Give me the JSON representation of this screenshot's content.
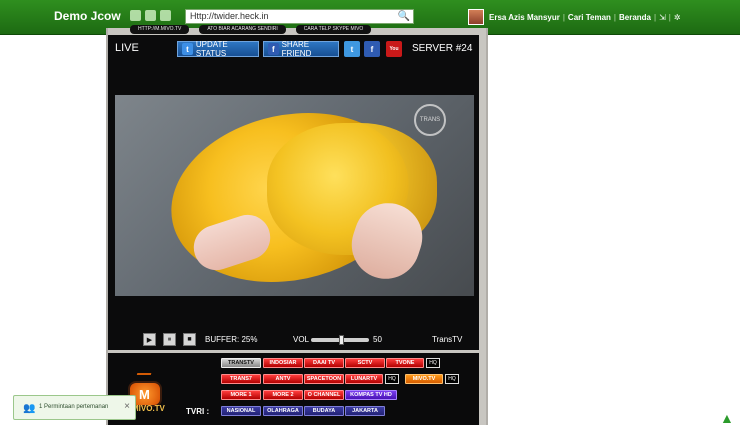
{
  "header": {
    "brand": "Demo Jcow",
    "url": "Http://twider.heck.in",
    "user_name": "Ersa Azis Mansyur",
    "nav_find_friends": "Cari Teman",
    "nav_home": "Beranda"
  },
  "player": {
    "live_label": "LIVE",
    "update_status": "UPDATE STATUS",
    "share_friend": "SHARE FRIEND",
    "server_label": "SERVER #24",
    "buffer_label": "BUFFER: 25%",
    "vol_label": "VOL",
    "vol_value": "50",
    "channel_name": "TransTV",
    "ticker_left": "HTTP://M.MIVO.TV",
    "ticker_mid": "ATO BIAR ACARANG SENDIRI",
    "ticker_right": "CARA TELP SKYPE MIVO"
  },
  "channels": {
    "row1": [
      {
        "label": "TRANSTV",
        "color": "gray"
      },
      {
        "label": "INDOSIAR",
        "color": "red"
      },
      {
        "label": "DAAI TV",
        "color": "red"
      },
      {
        "label": "SCTV",
        "color": "red"
      },
      {
        "label": "TVONE",
        "color": "red"
      }
    ],
    "row2": [
      {
        "label": "TRANS7",
        "color": "red"
      },
      {
        "label": "ANTV",
        "color": "red"
      },
      {
        "label": "SPACETOON",
        "color": "red"
      },
      {
        "label": "LUNARTV",
        "color": "red"
      },
      {
        "label": "MIVO.TV",
        "color": "orange"
      }
    ],
    "row3": [
      {
        "label": "MORE 1",
        "color": "red"
      },
      {
        "label": "MORE 2",
        "color": "red"
      },
      {
        "label": "O CHANNEL",
        "color": "red"
      },
      {
        "label": "KOMPAS TV HD",
        "color": "purple"
      }
    ],
    "row4_label": "TVRI :",
    "row4": [
      {
        "label": "NASIONAL",
        "color": "navy"
      },
      {
        "label": "OLAHRAGA",
        "color": "navy"
      },
      {
        "label": "BUDAYA",
        "color": "navy"
      },
      {
        "label": "JAKARTA",
        "color": "navy"
      }
    ],
    "hq": "HQ"
  },
  "mivo_logo": "M",
  "mivo_text": "MIVO.TV",
  "notification": {
    "text": "1 Permintaan pertemanan"
  }
}
